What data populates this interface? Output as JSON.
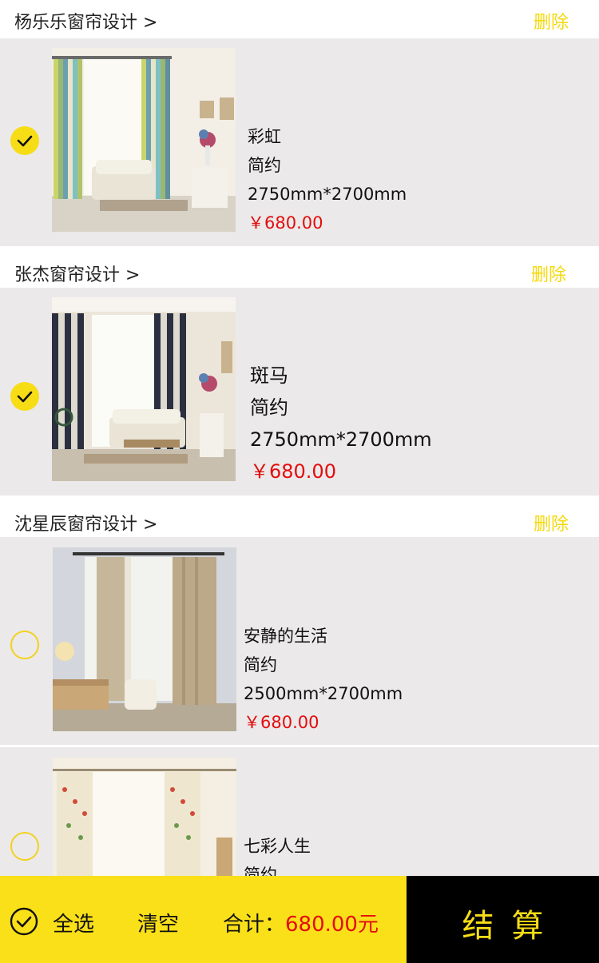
{
  "groups": [
    {
      "title": "杨乐乐窗帘设计 >",
      "delete_label": "删除",
      "items": [
        {
          "name": "彩虹",
          "style": "简约",
          "size": "2750mm*2700mm",
          "price": "￥680.00",
          "selected": true
        }
      ]
    },
    {
      "title": "张杰窗帘设计 >",
      "delete_label": "删除",
      "items": [
        {
          "name": "斑马",
          "style": "简约",
          "size": "2750mm*2700mm",
          "price": "￥680.00",
          "selected": true
        }
      ]
    },
    {
      "title": "沈星辰窗帘设计 >",
      "delete_label": "删除",
      "items": [
        {
          "name": "安静的生活",
          "style": "简约",
          "size": "2500mm*2700mm",
          "price": "￥680.00",
          "selected": false
        },
        {
          "name": "七彩人生",
          "style": "简约",
          "selected": false
        }
      ]
    }
  ],
  "footer": {
    "select_all_label": "全选",
    "clear_label": "清空",
    "total_label": "合计：",
    "total_amount": "680.00元",
    "checkout_label": "结算"
  },
  "colors": {
    "accent_yellow": "#fae019",
    "price_red": "#e30d0d",
    "row_bg": "#ebe9ea",
    "checkout_bg": "#000000"
  },
  "icons": [
    "check-circle-icon",
    "empty-circle-icon",
    "select-all-check-icon"
  ]
}
